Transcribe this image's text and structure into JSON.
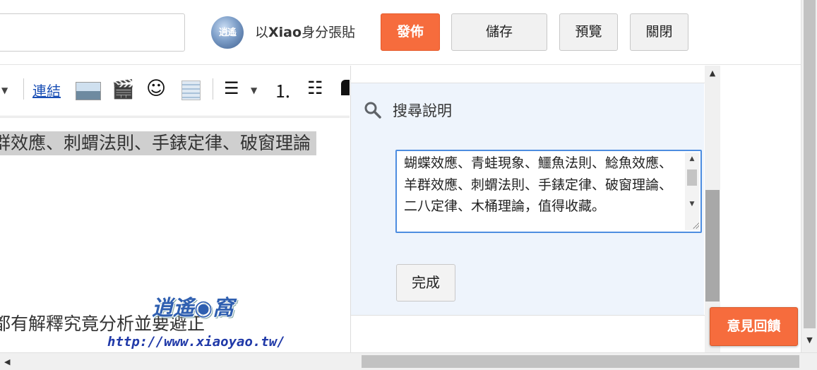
{
  "header": {
    "author_prefix": "以",
    "author_name": "Xiao",
    "author_suffix": "身分張貼",
    "publish_label": "發佈",
    "save_label": "儲存",
    "preview_label": "預覽",
    "close_label": "關閉"
  },
  "toolbar": {
    "link_label": "連結",
    "video_glyph": "🎬",
    "emoji_glyph": "☺",
    "align_glyph": "☰",
    "ordered_list_glyph": "⒈",
    "bullet_list_glyph": "☷"
  },
  "editor": {
    "line1": "群效應、刺蝟法則、手錶定律、破窗理論",
    "line2": "都有解釋究竟分析並要避正"
  },
  "watermark": {
    "url": "http://www.xiaoyao.tw/"
  },
  "panel": {
    "search_label": "搜尋說明",
    "description_text": "蝴蝶效應、青蛙現象、鱷魚法則、鯰魚效應、羊群效應、刺蝟法則、手錶定律、破窗理論、二八定律、木桶理論，值得收藏。",
    "done_label": "完成"
  },
  "feedback_label": "意見回饋",
  "colors": {
    "accent": "#f66c3d",
    "panel_bg": "#eef4fc",
    "focus_border": "#4d8de0"
  }
}
